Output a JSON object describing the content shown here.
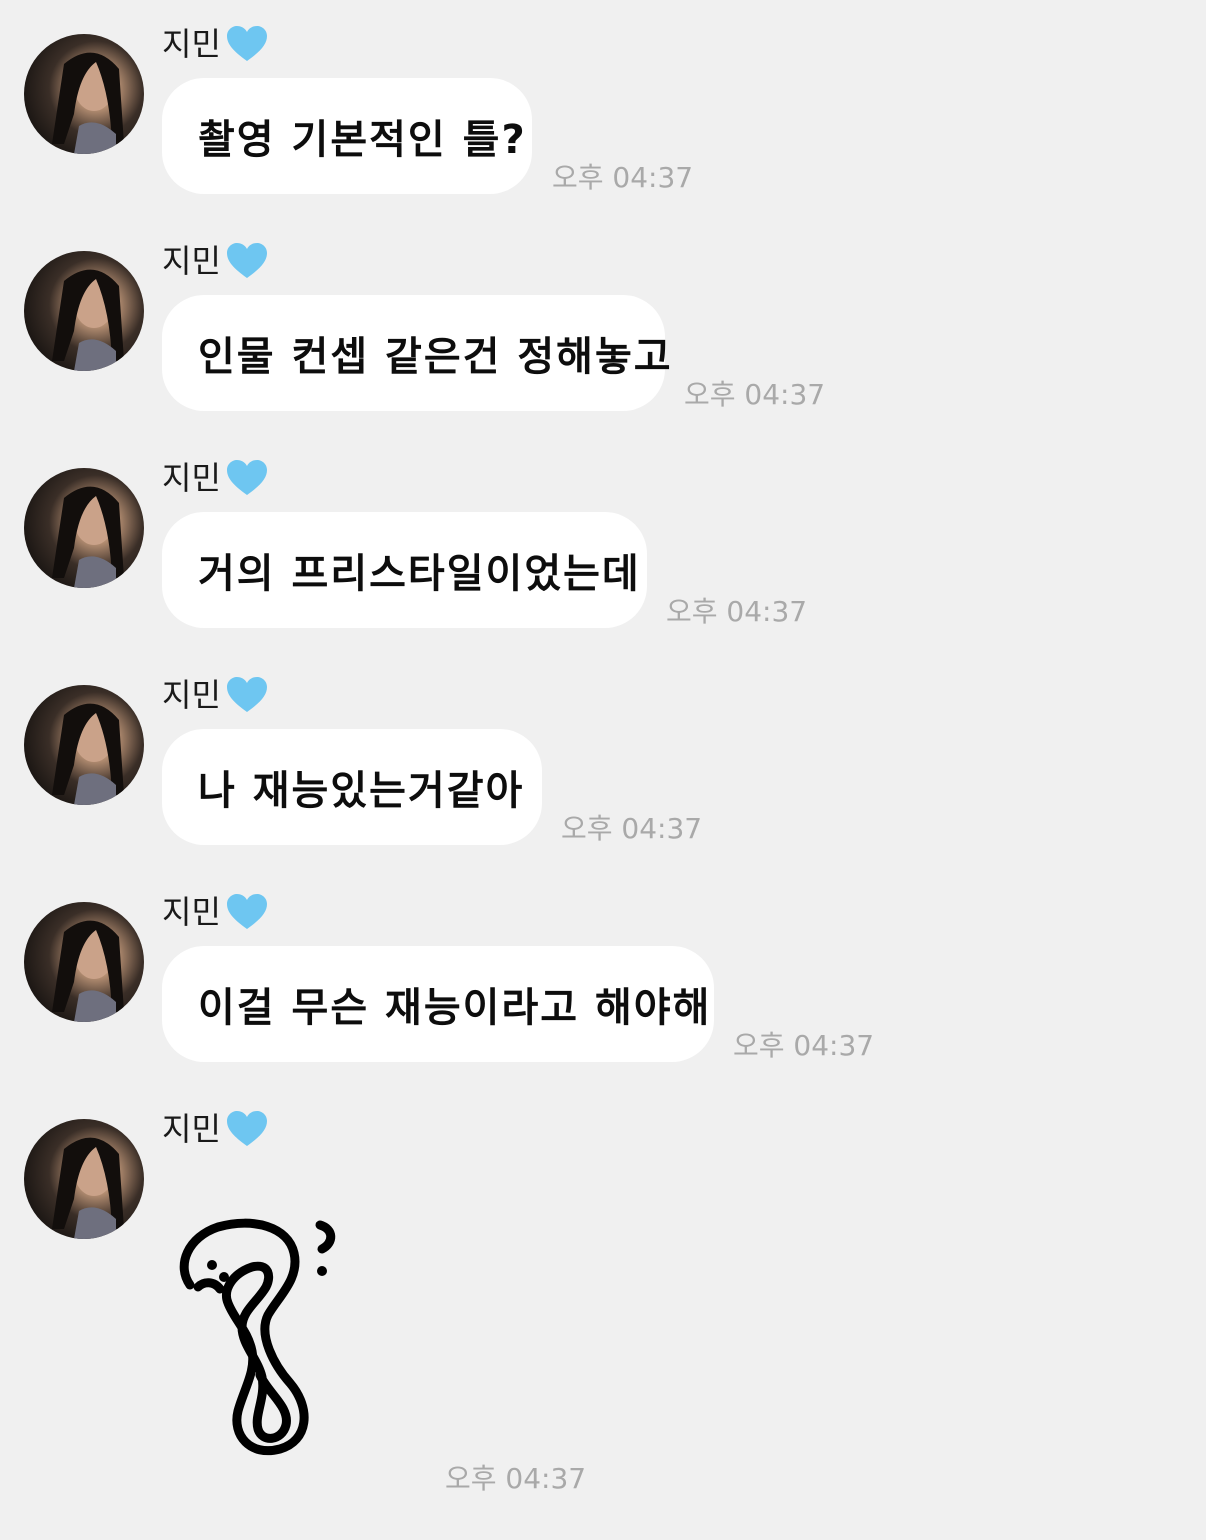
{
  "sender": {
    "name": "지민",
    "name_icon": "light-blue-heart-icon",
    "name_icon_color": "#6ec6f1"
  },
  "messages": [
    {
      "text": "촬영 기본적인 틀?",
      "time": "오후 04:37"
    },
    {
      "text": "인물 컨셉 같은건 정해놓고",
      "time": "오후 04:37"
    },
    {
      "text": "거의 프리스타일이었는데",
      "time": "오후 04:37"
    },
    {
      "text": "나 재능있는거같아",
      "time": "오후 04:37"
    },
    {
      "text": "이걸 무슨 재능이라고 해야해",
      "time": "오후 04:37"
    }
  ],
  "sticker_message": {
    "sticker": "hand-drawn-question-mark-sticker",
    "time": "오후 04:37"
  },
  "colors": {
    "background": "#f0f0f0",
    "bubble": "#ffffff",
    "timestamp": "#a9a9a9"
  }
}
